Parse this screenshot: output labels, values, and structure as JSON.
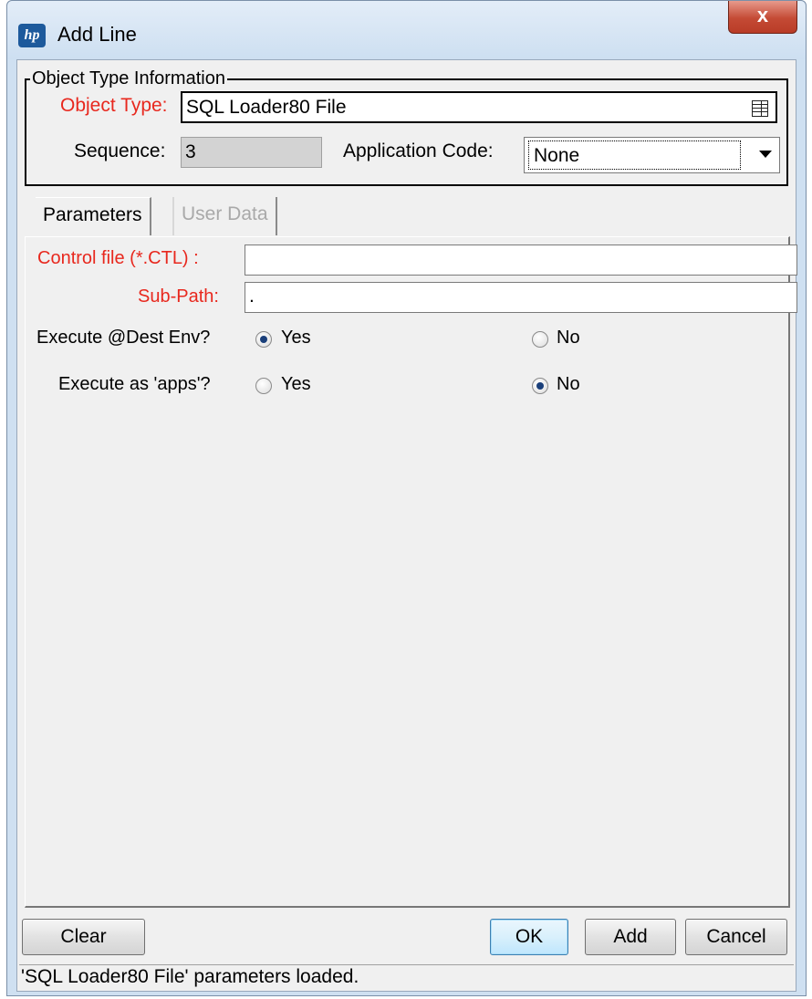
{
  "window": {
    "title": "Add Line",
    "logo_text": "hp",
    "close_label": "x"
  },
  "object_type_info": {
    "legend": "Object Type Information",
    "object_type_label": "Object Type:",
    "object_type_value": "SQL Loader80 File",
    "sequence_label": "Sequence:",
    "sequence_value": "3",
    "application_code_label": "Application Code:",
    "application_code_value": "None"
  },
  "tabs": [
    {
      "label": "Parameters",
      "active": true
    },
    {
      "label": "User Data",
      "active": false
    }
  ],
  "parameters": {
    "control_file_label": "Control file (*.CTL) :",
    "control_file_value": "",
    "sub_path_label": "Sub-Path:",
    "sub_path_value": ".",
    "execute_dest_env": {
      "label": "Execute @Dest Env?",
      "options": [
        "Yes",
        "No"
      ],
      "selected": "Yes"
    },
    "execute_as_apps": {
      "label": "Execute as 'apps'?",
      "options": [
        "Yes",
        "No"
      ],
      "selected": "No"
    }
  },
  "buttons": {
    "clear": "Clear",
    "ok": "OK",
    "add": "Add",
    "cancel": "Cancel"
  },
  "status": {
    "message": "'SQL Loader80 File' parameters loaded."
  },
  "colors": {
    "required_label": "#e8281e",
    "disabled_tab": "#a9a9a9",
    "close_button": "#c44a35"
  }
}
